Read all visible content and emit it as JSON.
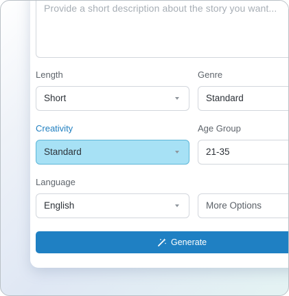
{
  "description": {
    "placeholder": "Provide a short description about the story you want..."
  },
  "length": {
    "label": "Length",
    "value": "Short"
  },
  "genre": {
    "label": "Genre",
    "value": "Standard"
  },
  "creativity": {
    "label": "Creativity",
    "value": "Standard"
  },
  "age_group": {
    "label": "Age Group",
    "value": "21-35"
  },
  "language": {
    "label": "Language",
    "value": "English"
  },
  "more_options": {
    "label": "More Options"
  },
  "generate": {
    "label": "Generate",
    "icon": "magic-wand-icon"
  },
  "colors": {
    "accent": "#1f80c3",
    "active_field_bg": "#a7e1f5",
    "active_label": "#1f7fc0"
  }
}
